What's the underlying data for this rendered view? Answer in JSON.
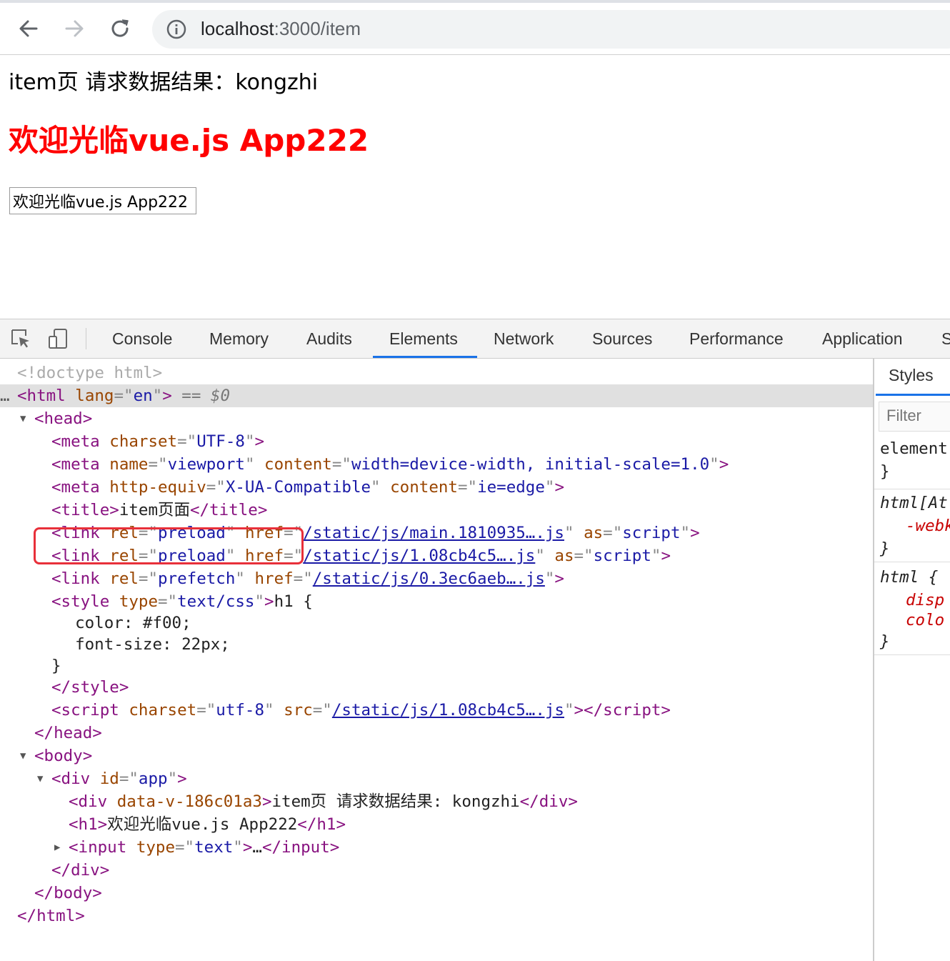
{
  "browser": {
    "url_host": "localhost",
    "url_path": ":3000/item",
    "icons": [
      "back-arrow-icon",
      "forward-arrow-icon",
      "reload-icon",
      "info-icon"
    ]
  },
  "page": {
    "line1": "item页 请求数据结果：kongzhi",
    "heading": "欢迎光临vue.js App222",
    "input_value": "欢迎光临vue.js App222"
  },
  "devtools": {
    "tabs": [
      "Console",
      "Memory",
      "Audits",
      "Elements",
      "Network",
      "Sources",
      "Performance",
      "Application",
      "S"
    ],
    "active_tab": "Elements",
    "dom": {
      "doctype": "<!doctype html>",
      "html_lang": "en",
      "dollar_ref": "== $0",
      "meta_charset": "UTF-8",
      "meta_viewport_name": "viewport",
      "meta_viewport_content": "width=device-width, initial-scale=1.0",
      "meta_http_equiv": "X-UA-Compatible",
      "meta_http_content": "ie=edge",
      "title_text": "item页面",
      "link1_rel": "preload",
      "link1_href": "/static/js/main.1810935….js",
      "link1_as": "script",
      "link2_rel": "preload",
      "link2_href": "/static/js/1.08cb4c5….js",
      "link2_as": "script",
      "link3_rel": "prefetch",
      "link3_href": "/static/js/0.3ec6aeb….js",
      "style_type": "text/css",
      "style_line1": "h1 {",
      "style_line2": "  color: #f00;",
      "style_line3": "  font-size: 22px;",
      "style_line4": "}",
      "script_charset": "utf-8",
      "script_src": "/static/js/1.08cb4c5….js",
      "div_id": "app",
      "inner_div_attr": "data-v-186c01a3",
      "inner_div_text": "item页 请求数据结果: kongzhi",
      "h1_text": "欢迎光临vue.js App222",
      "input_type": "text",
      "ellipsis": "…"
    },
    "styles": {
      "tab": "Styles",
      "filter_placeholder": "Filter",
      "rule1_selector": "element",
      "rule1_close": "}",
      "rule2_selector": "html[At",
      "rule2_prop": "-webk",
      "rule2_close": "}",
      "rule3_selector": "html {",
      "rule3_prop1": "disp",
      "rule3_prop2": "colo",
      "rule3_close": "}"
    }
  }
}
